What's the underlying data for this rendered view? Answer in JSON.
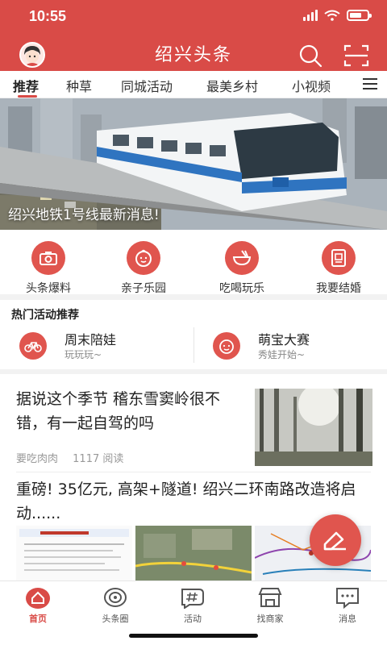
{
  "status_bar": {
    "time": "10:55"
  },
  "header": {
    "title": "绍兴头条",
    "icons": [
      "avatar",
      "search-icon",
      "scan-icon"
    ]
  },
  "tabs": [
    {
      "label": "推荐",
      "active": true
    },
    {
      "label": "种草"
    },
    {
      "label": "同城活动"
    },
    {
      "label": "最美乡村"
    },
    {
      "label": "小视频"
    }
  ],
  "hero": {
    "caption": "绍兴地铁1号线最新消息!"
  },
  "quick_links": [
    {
      "label": "头条爆料",
      "icon": "camera-icon"
    },
    {
      "label": "亲子乐园",
      "icon": "baby-face-icon"
    },
    {
      "label": "吃喝玩乐",
      "icon": "bowl-icon"
    },
    {
      "label": "我要结婚",
      "icon": "wedding-icon"
    }
  ],
  "hot_activities": {
    "title": "热门活动推荐",
    "items": [
      {
        "name": "周末陪娃",
        "sub": "玩玩玩~",
        "icon": "bicycle-icon"
      },
      {
        "name": "萌宝大赛",
        "sub": "秀娃开始~",
        "icon": "baby-face-icon"
      }
    ]
  },
  "feed": {
    "articles": [
      {
        "title": "据说这个季节 稽东雪窦岭很不错，有一起自驾的吗",
        "author": "要吃肉肉",
        "reads": "1117 阅读"
      },
      {
        "title": "重磅! 35亿元, 高架+隧道! 绍兴二环南路改造将启动......"
      }
    ]
  },
  "tabbar": [
    {
      "label": "首页",
      "icon": "home-icon",
      "active": true
    },
    {
      "label": "头条圈",
      "icon": "circle-icon"
    },
    {
      "label": "活动",
      "icon": "hashtag-icon"
    },
    {
      "label": "找商家",
      "icon": "store-icon"
    },
    {
      "label": "消息",
      "icon": "message-icon"
    }
  ],
  "colors": {
    "brand": "#d94b47",
    "accent": "#e0554e"
  }
}
